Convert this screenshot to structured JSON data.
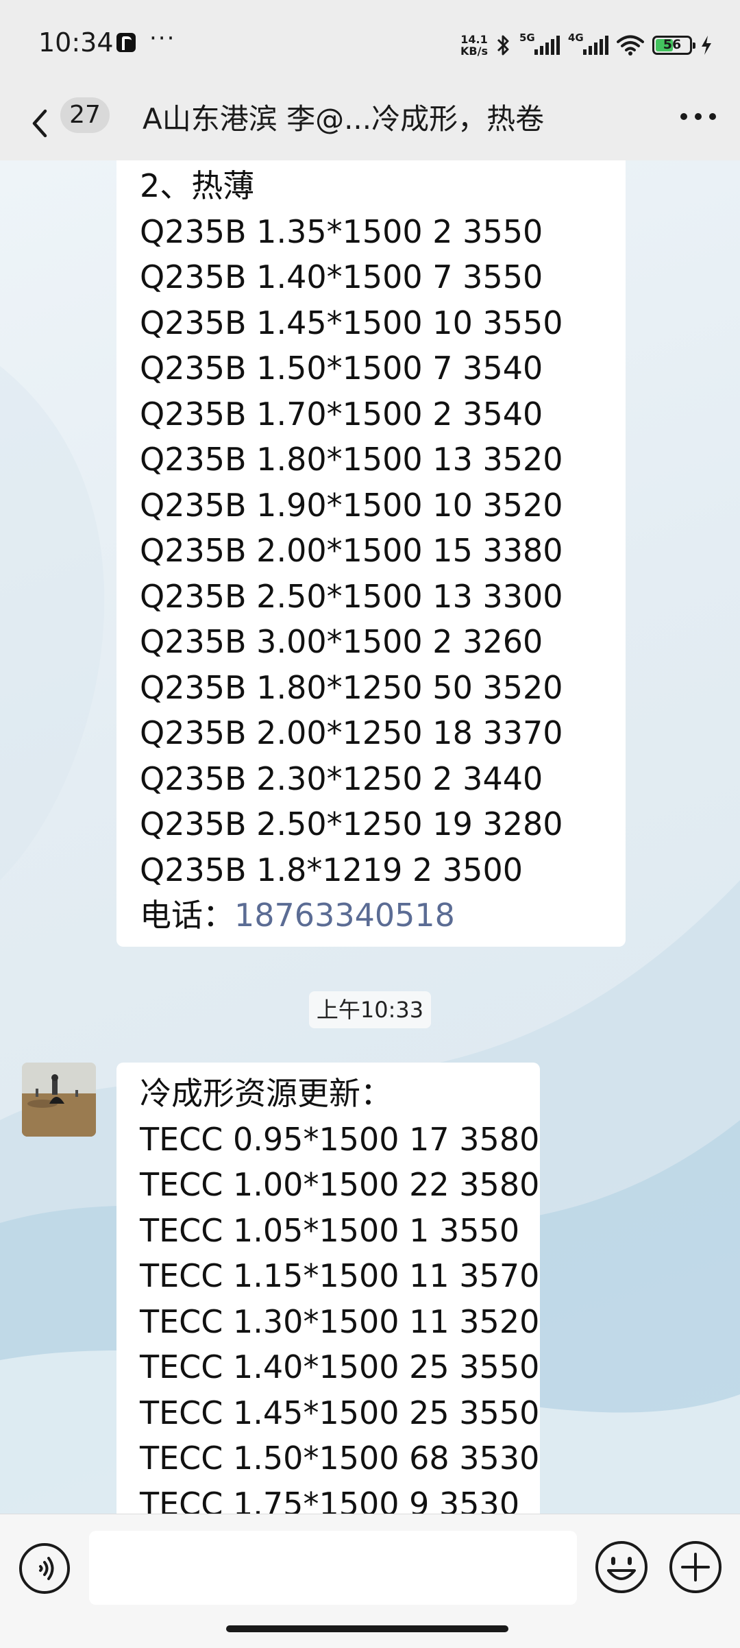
{
  "status_bar": {
    "time": "10:34",
    "more": "···",
    "net_speed_value": "14.1",
    "net_speed_unit": "KB/s",
    "network_1": "5G",
    "network_2": "4G",
    "battery": "56"
  },
  "nav": {
    "unread_count": "27",
    "title": "A山东港滨 李@...冷成形，热卷"
  },
  "messages": {
    "first": {
      "lines": [
        "2、热薄",
        "Q235B 1.35*1500 2 3550",
        "Q235B 1.40*1500 7 3550",
        "Q235B 1.45*1500 10 3550",
        "Q235B 1.50*1500 7 3540",
        "Q235B 1.70*1500 2 3540",
        "Q235B 1.80*1500 13 3520",
        "Q235B 1.90*1500 10 3520",
        "Q235B 2.00*1500 15 3380",
        "Q235B 2.50*1500 13 3300",
        "Q235B 3.00*1500 2 3260",
        "Q235B 1.80*1250 50 3520",
        "Q235B 2.00*1250 18 3370",
        "Q235B 2.30*1250 2 3440",
        "Q235B 2.50*1250 19 3280",
        "Q235B 1.8*1219 2 3500"
      ],
      "phone_label": "电话：",
      "phone_number": "18763340518"
    },
    "timestamp": "上午10:33",
    "second": {
      "lines": [
        "冷成形资源更新：",
        "TECC 0.95*1500 17 3580",
        "TECC 1.00*1500 22 3580",
        "TECC 1.05*1500 1 3550",
        "TECC 1.15*1500 11 3570",
        "TECC 1.30*1500 11 3520",
        "TECC 1.40*1500 25 3550",
        "TECC 1.45*1500 25 3550",
        "TECC 1.50*1500 68 3530",
        "TECC 1.75*1500 9 3530"
      ]
    }
  },
  "input": {
    "value": "",
    "placeholder": ""
  },
  "colors": {
    "link": "#5b6c94",
    "battery": "#43c25e"
  },
  "icons": [
    "back-icon",
    "more-icon",
    "voice-icon",
    "emoji-icon",
    "plus-icon",
    "wifi-icon",
    "bluetooth-icon",
    "charging-icon"
  ]
}
